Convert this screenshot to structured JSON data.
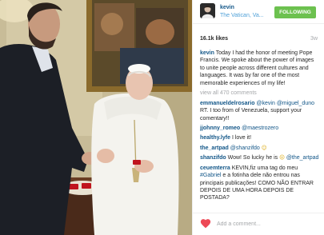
{
  "post": {
    "author": "kevin",
    "location": "The Vatican, Va...",
    "follow_label": "FOLLOWING",
    "likes": "16.1k likes",
    "age": "3w",
    "caption_user": "kevin",
    "caption_text": " Today I had the honor of meeting Pope Francis. We spoke about the power of images to unite people across different cultures and languages. It was by far one of the most memorable experiences of my life!",
    "view_all": "view all 470 comments"
  },
  "comments": [
    {
      "user": "emmanueldelrosario",
      "mention": "@kevin @miguel_duno",
      "text": " RT. I too from of Venezuela, support your comentary!!"
    },
    {
      "user": "jjohnny_romeo",
      "mention": "@maestrozero",
      "text": ""
    },
    {
      "user": "healthy.lyfe",
      "mention": "",
      "text": " I love it!"
    },
    {
      "user": "the_artpad",
      "mention": "@shanzifdo",
      "text": "",
      "emoji": "☺"
    },
    {
      "user": "shanzifdo",
      "mention": "@the_artpad",
      "text": " Wow! So lucky he is ",
      "emoji": "☹"
    },
    {
      "user": "ceuemterra",
      "mention": "",
      "text": " KEVIN,fiz uma tag do meu ",
      "tag": "#Gabriel",
      "text2": " e a fotinha dele não entrou nas principais publicações! COMO NÃO ENTRAR DEPOIS DE UMA HORA DEPOIS DE POSTADA?"
    }
  ],
  "footer": {
    "comment_placeholder": "Add a comment..."
  },
  "icons": {
    "like": "heart-icon",
    "avatar": "profile-avatar"
  },
  "colors": {
    "link": "#125688",
    "location": "#4fa0d8",
    "follow": "#6cc14f",
    "heart": "#ed4956",
    "muted": "#a5a7aa"
  }
}
